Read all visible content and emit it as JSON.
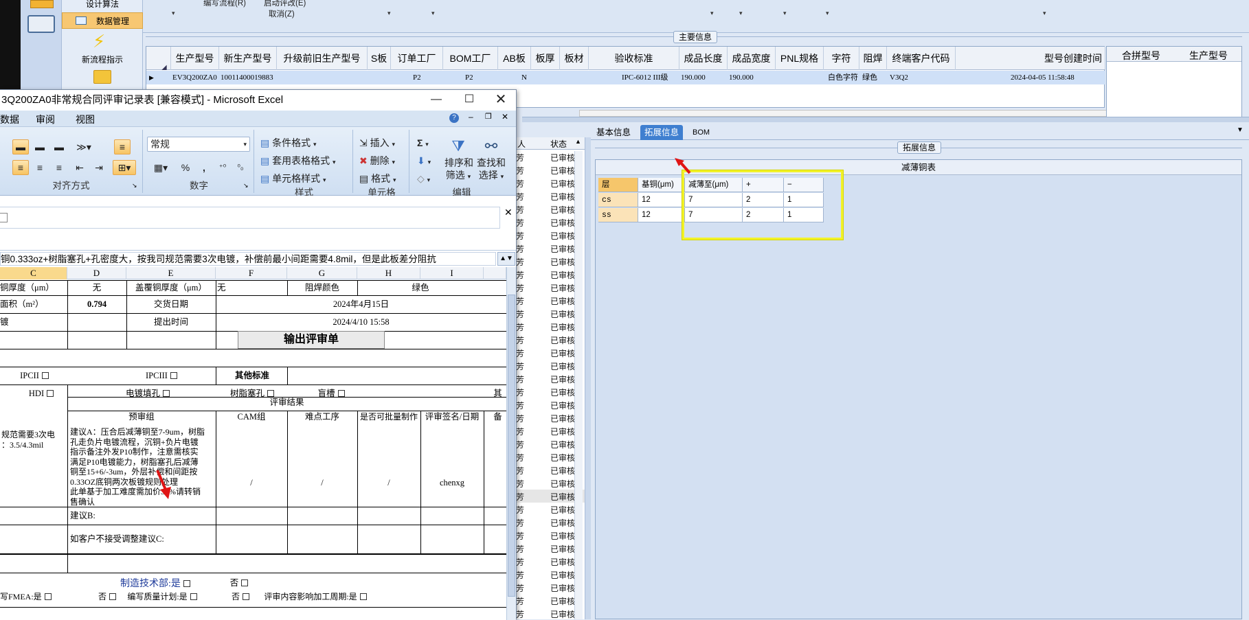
{
  "nav": {
    "design": "设计算法",
    "data": "数据管理",
    "flow": "新流程指示"
  },
  "topmenu": {
    "edit_flow": "编写流程(R)",
    "start_review": "启动评改(E)",
    "cancel": "取消(Z)"
  },
  "main_info": {
    "title": "主要信息",
    "headers": [
      "生产型号",
      "新生产型号",
      "升级前旧生产型号",
      "S板",
      "订单工厂",
      "BOM工厂",
      "AB板",
      "板厚",
      "板材",
      "验收标准",
      "成品长度",
      "成品宽度",
      "PNL规格",
      "字符",
      "阻焊",
      "终端客户代码",
      "型号创建时间"
    ],
    "row": [
      "EV3Q200ZA0",
      "10011400019883",
      "",
      "",
      "P2",
      "P2",
      "N",
      "",
      "",
      "IPC-6012 III级",
      "190.000",
      "190.000",
      "",
      "白色字符",
      "绿色",
      "V3Q2",
      "2024-04-05 11:58:48"
    ],
    "right_headers": [
      "合拼型号",
      "生产型号"
    ]
  },
  "tabs": [
    "基本信息",
    "拓展信息",
    "BOM"
  ],
  "ext_info": {
    "title": "拓展信息",
    "table_title": "减薄铜表",
    "headers": [
      "层",
      "基铜(μm)",
      "减薄至(μm)",
      "+",
      "−"
    ],
    "rows": [
      [
        "cs",
        "12",
        "7",
        "2",
        "1"
      ],
      [
        "ss",
        "12",
        "7",
        "2",
        "1"
      ]
    ]
  },
  "list": {
    "headers": [
      "人",
      "状态"
    ],
    "row_a": "芳",
    "row_b": "已审核"
  },
  "excel": {
    "title": "3Q200ZA0非常规合同评审记录表  [兼容模式] - Microsoft Excel",
    "menu": [
      "数据",
      "审阅",
      "视图"
    ],
    "ribbon": {
      "align_label": "对齐方式",
      "number_label": "数字",
      "style_label": "样式",
      "cells_label": "单元格",
      "edit_label": "编辑",
      "number_format": "常规",
      "cond_format": "条件格式",
      "table_format": "套用表格格式",
      "cell_style": "单元格样式",
      "insert": "插入",
      "delete": "删除",
      "format": "格式",
      "sort_filter_1": "排序和",
      "sort_filter_2": "筛选",
      "find_select_1": "查找和",
      "find_select_2": "选择",
      "sigma": "Σ",
      "percent": "%",
      "comma": ","
    },
    "formula_text": "铜0.333oz+树脂塞孔+孔密度大，按我司规范需要3次电镀，补偿前最小间距需要4.8mil，但是此板差分阻抗",
    "columns": [
      "C",
      "D",
      "E",
      "F",
      "G",
      "H",
      "I"
    ],
    "cells": {
      "r1c": "铜厚度（μm）",
      "r1d": "无",
      "r1e": "盖覆铜厚度（μm）",
      "r1f": "无",
      "r1g": "阻焊颜色",
      "r1i": "绿色",
      "r2c": "面积（m²）",
      "r2d": "0.794",
      "r2e": "交货日期",
      "r2fi": "2024年4月15日",
      "r3c": "镀",
      "r3e": "提出时间",
      "r3fi": "2024/4/10 15:58",
      "output_btn": "输出评审单",
      "ipc2": "IPCII",
      "ipc3": "IPCIII",
      "other_std": "其他标准",
      "hdi": "HDI",
      "plating_fill": "电镀填孔",
      "resin_plug": "树脂塞孔",
      "blind_slot": "盲槽",
      "other": "其",
      "review_result": "评审结果",
      "pre_review": "预审组",
      "cam": "CAM组",
      "hard_process": "难点工序",
      "batch": "是否可批量制作",
      "signoff": "评审签名/日期",
      "remark": "备",
      "left_note": "规范需要3次电\n：3.5/4.3mil",
      "suggest_a": "建议A：压合后减薄铜至7-9um，树脂\n孔走负片电镀流程，沉铜+负片电镀\n指示备注外发P10制作，注意需核实\n满足P10电镀能力，树脂塞孔后减薄\n铜至15+6/-3um，外层补偿和间距按\n0.33OZ底铜两次板镀规则处理\n此单基于加工难度需加价30%请转销\n售确认",
      "slash": "/",
      "signer": "chenxg",
      "suggest_b": "建议B:",
      "suggest_c": "如客户不接受调整建议C:",
      "mfg_dept": "制造技术部:是",
      "no": "否",
      "fmea": "写FMEA:是",
      "quality_plan": "编写质量计划:是",
      "cycle": "评审内容影响加工周期:是"
    }
  }
}
